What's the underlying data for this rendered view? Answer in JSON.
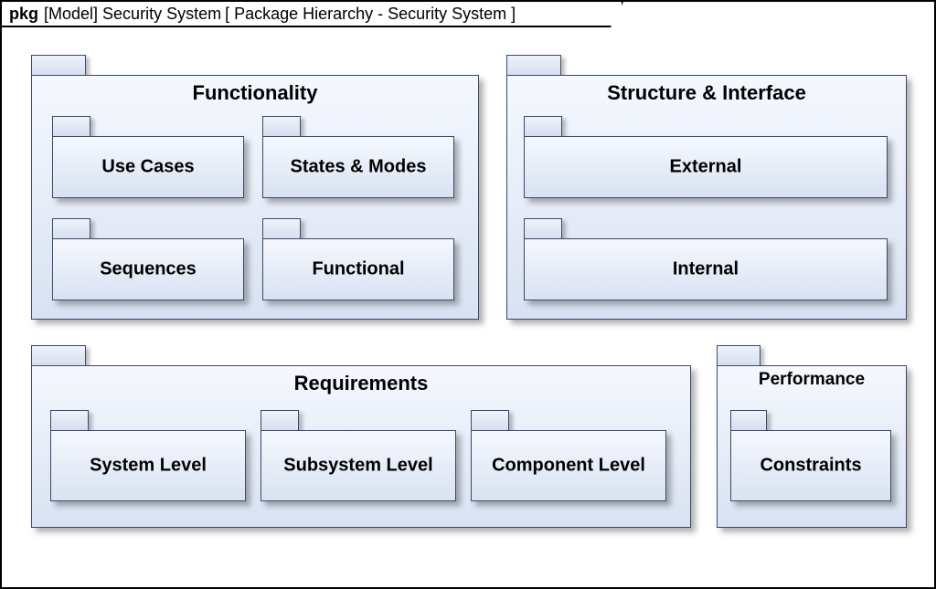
{
  "frame": {
    "keyword": "pkg",
    "context": "[Model] Security System",
    "name": "[ Package Hierarchy - Security System  ]"
  },
  "packages": {
    "functionality": {
      "title": "Functionality",
      "children": {
        "use_cases": "Use Cases",
        "states_modes": "States & Modes",
        "sequences": "Sequences",
        "functional": "Functional"
      }
    },
    "structure": {
      "title": "Structure & Interface",
      "children": {
        "external": "External",
        "internal": "Internal"
      }
    },
    "requirements": {
      "title": "Requirements",
      "children": {
        "system": "System Level",
        "subsystem": "Subsystem Level",
        "component": "Component Level"
      }
    },
    "performance": {
      "title": "Performance",
      "children": {
        "constraints": "Constraints"
      }
    }
  }
}
